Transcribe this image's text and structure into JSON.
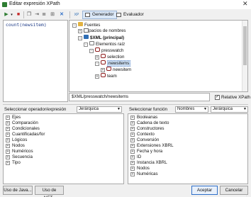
{
  "window": {
    "title": "Editar expresión XPath"
  },
  "toolbar": {
    "generador": "Generador",
    "evaluador": "Evaluador"
  },
  "expression": "count(newsitem)",
  "tree": [
    {
      "id": "fuentes",
      "label": "Fuentes",
      "icon": "folder",
      "pm": "-"
    },
    {
      "id": "espacios",
      "label": "Espacios de nombres",
      "icon": "list",
      "pm": "+"
    },
    {
      "id": "xml",
      "label": "$XML (principal)",
      "icon": "xml",
      "pm": "-",
      "bold": true
    },
    {
      "id": "elementos",
      "label": "Elementos raíz",
      "icon": "elem",
      "pm": "-"
    },
    {
      "id": "presswatch",
      "label": "presswatch",
      "icon": "brace",
      "pm": "-"
    },
    {
      "id": "selection",
      "label": "selection",
      "icon": "brace",
      "pm": "+"
    },
    {
      "id": "newsitems",
      "label": "newsitems",
      "icon": "brace",
      "pm": "-",
      "selected": true
    },
    {
      "id": "newsitem",
      "label": "newsitem",
      "icon": "brace",
      "pm": "+"
    },
    {
      "id": "team",
      "label": "team",
      "icon": "brace",
      "pm": "+"
    }
  ],
  "path": "$XML/presswatch/newsitems",
  "relative_xpath": {
    "label": "Relative XPath",
    "checked": true
  },
  "operators": {
    "title": "Seleccionar operador/expresión",
    "view": "Jerárquica",
    "items": [
      "Ejes",
      "Comparación",
      "Condicionales",
      "Cuantificadas/for",
      "Lógicos",
      "Nodos",
      "Numéricos",
      "Secuencia",
      "Tipo"
    ]
  },
  "functions": {
    "title": "Seleccionar función",
    "mode": "Nombres",
    "view": "Jerárquica",
    "items": [
      "Booleanas",
      "Cadena de texto",
      "Constructores",
      "Contexto",
      "Conversión",
      "Extensiones XBRL",
      "Fecha y hora",
      "ID",
      "Instancia XBRL",
      "Nodos",
      "Numéricas"
    ]
  },
  "buttons": {
    "java": "Uso de Java...",
    "net": "Uso de .NET...",
    "ok": "Aceptar",
    "cancel": "Cancelar"
  },
  "colors": {
    "accent": "#2f6fc8",
    "selection": "#cde0f5",
    "xml_icon": "#2e6db4",
    "element_icon": "#8d1d1d"
  }
}
